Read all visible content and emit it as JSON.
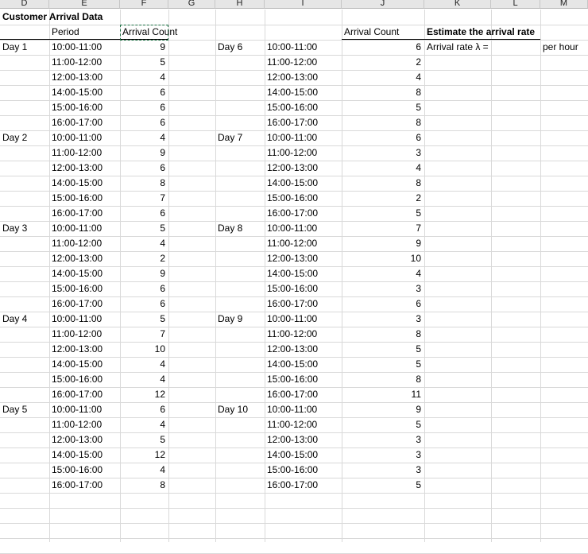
{
  "columns": [
    "D",
    "E",
    "F",
    "G",
    "H",
    "I",
    "J",
    "K",
    "L",
    "M"
  ],
  "title": "Customer Arrival Data",
  "headers": {
    "period": "Period",
    "arrival_count_1": "Arrival Count",
    "arrival_count_2": "Arrival Count"
  },
  "estimate": {
    "title": "Estimate the arrival rate",
    "label": "Arrival rate λ =",
    "unit": "per hour"
  },
  "periods": [
    "10:00-11:00",
    "11:00-12:00",
    "12:00-13:00",
    "14:00-15:00",
    "15:00-16:00",
    "16:00-17:00"
  ],
  "left_days": [
    {
      "day": "Day 1",
      "counts": [
        9,
        5,
        4,
        6,
        6,
        6
      ]
    },
    {
      "day": "Day 2",
      "counts": [
        4,
        9,
        6,
        8,
        7,
        6
      ]
    },
    {
      "day": "Day 3",
      "counts": [
        5,
        4,
        2,
        9,
        6,
        6
      ]
    },
    {
      "day": "Day 4",
      "counts": [
        5,
        7,
        10,
        4,
        4,
        12
      ]
    },
    {
      "day": "Day 5",
      "counts": [
        6,
        4,
        5,
        12,
        4,
        8
      ]
    }
  ],
  "right_days": [
    {
      "day": "Day 6",
      "counts": [
        6,
        2,
        4,
        8,
        5,
        8
      ]
    },
    {
      "day": "Day 7",
      "counts": [
        6,
        3,
        4,
        8,
        2,
        5
      ]
    },
    {
      "day": "Day 8",
      "counts": [
        7,
        9,
        10,
        4,
        3,
        6
      ]
    },
    {
      "day": "Day 9",
      "counts": [
        3,
        8,
        5,
        5,
        8,
        11
      ]
    },
    {
      "day": "Day 10",
      "counts": [
        9,
        5,
        3,
        3,
        3,
        5
      ]
    }
  ]
}
